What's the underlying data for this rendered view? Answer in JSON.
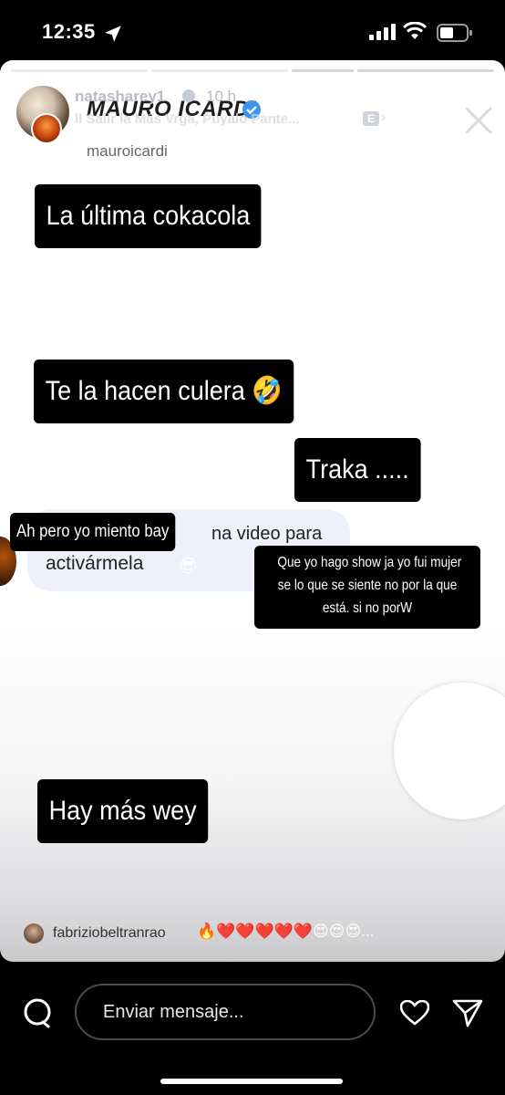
{
  "status_bar": {
    "time": "12:35"
  },
  "story": {
    "username": "natasharey1",
    "time_ago": "10 h",
    "music": "ll Salir la Más Vrga, Púyalo Pante...",
    "badge": "E",
    "profile_name": "MAURO ICARDI",
    "profile_handle": "mauroicardi",
    "captions": {
      "c1": "La última cokacola",
      "c2": "Te la hacen culera 🤣",
      "c3": "Traka .....",
      "c4": "Ah pero yo miento bay",
      "c5_line1": "Que yo hago show ja yo fui mujer",
      "c5_line2": "se lo que se siente no por la que",
      "c5_line3": "está. si no porW",
      "c6": "Hay más wey"
    },
    "chat": {
      "partial": "na video para",
      "line2": "activármela",
      "emoji": "😎"
    },
    "sticker_emoji": "😂",
    "reply": {
      "user": "fabriziobeltranrao",
      "emojis": "🔥❤️❤️❤️❤️❤️😍😍😍..."
    }
  },
  "bottom_bar": {
    "input_placeholder": "Enviar mensaje..."
  },
  "colors": {
    "bg": "#000000",
    "caption_bg": "#000000",
    "chat_bubble": "#eef0fb"
  }
}
